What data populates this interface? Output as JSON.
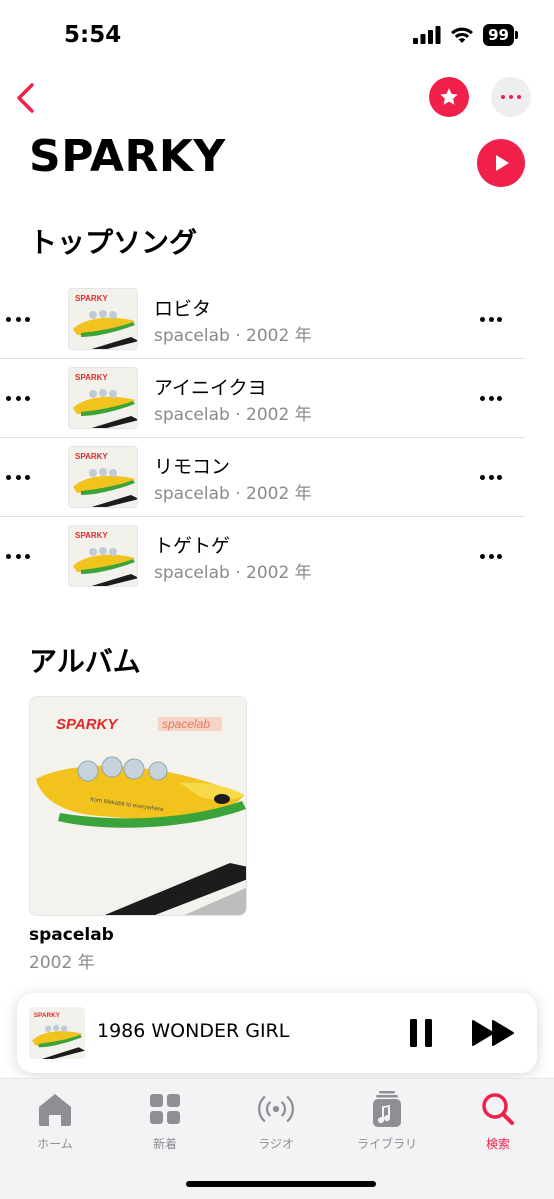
{
  "status_bar": {
    "time": "5:54",
    "battery": "99"
  },
  "artist": {
    "name": "SPARKY"
  },
  "top_songs": {
    "title": "トップソング",
    "songs": [
      {
        "title": "ロビタ",
        "subtitle": "spacelab · 2002 年"
      },
      {
        "title": "アイニイクヨ",
        "subtitle": "spacelab · 2002 年"
      },
      {
        "title": "リモコン",
        "subtitle": "spacelab · 2002 年"
      },
      {
        "title": "トゲトゲ",
        "subtitle": "spacelab · 2002 年"
      }
    ]
  },
  "albums": {
    "title": "アルバム",
    "items": [
      {
        "name": "spacelab",
        "year": "2002 年",
        "cover_title": "SPARKY",
        "cover_subtitle": "spacelab",
        "cover_caption": "from Mekabit to everywhere"
      }
    ]
  },
  "now_playing": {
    "title": "1986 WONDER GIRL"
  },
  "tabs": [
    {
      "label": "ホーム",
      "icon": "home-icon"
    },
    {
      "label": "新着",
      "icon": "grid-icon"
    },
    {
      "label": "ラジオ",
      "icon": "radio-icon"
    },
    {
      "label": "ライブラリ",
      "icon": "library-icon"
    },
    {
      "label": "検索",
      "icon": "search-icon",
      "active": true
    }
  ],
  "colors": {
    "accent": "#f0204a",
    "secondary_text": "#8a8a8e",
    "tab_inactive": "#8e8e93"
  }
}
